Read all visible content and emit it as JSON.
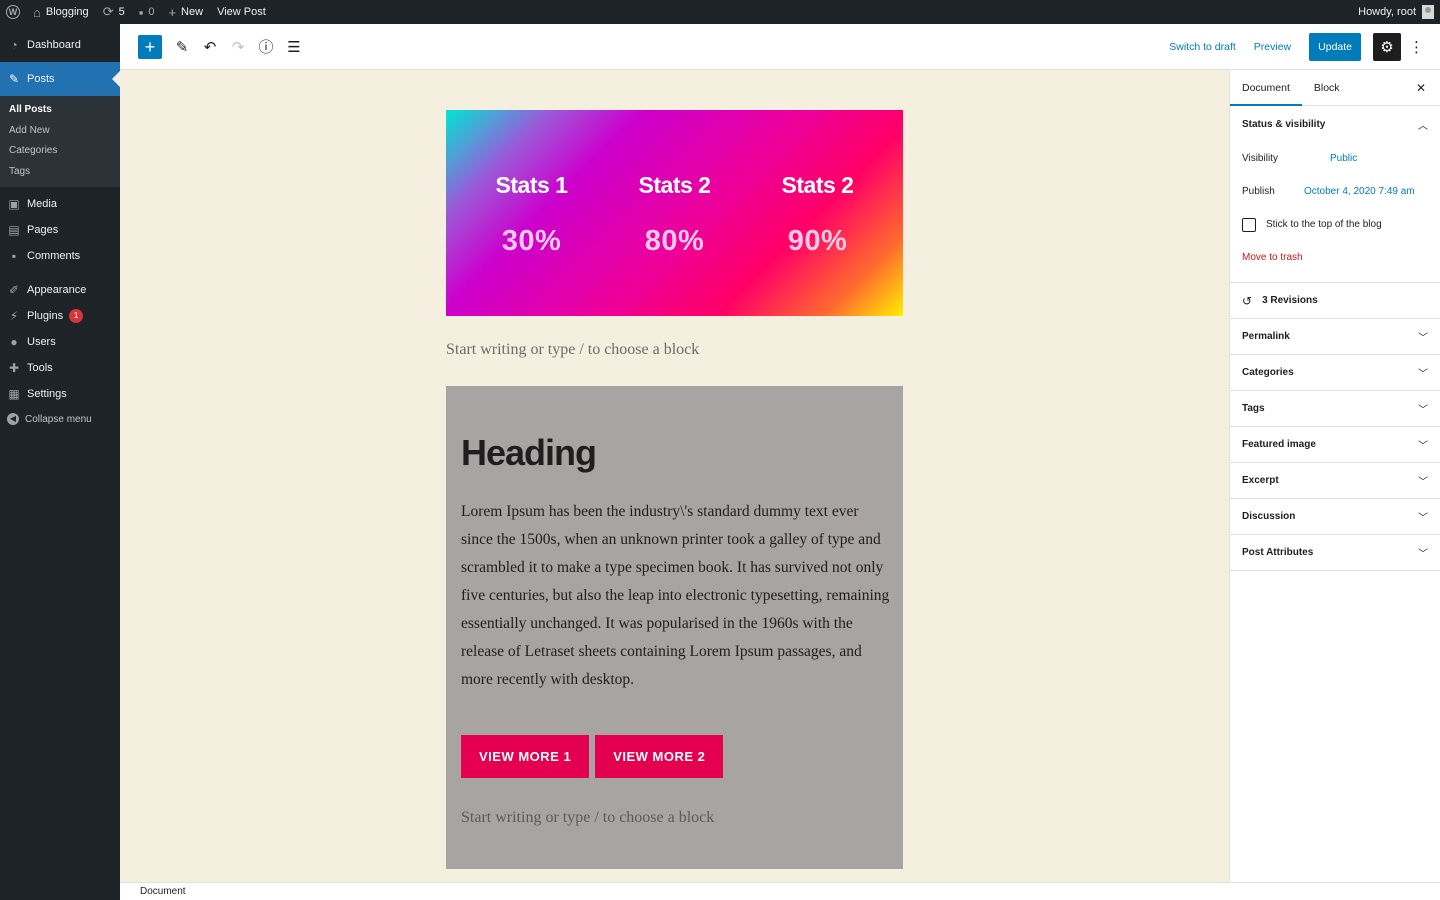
{
  "admin_bar": {
    "site_name": "Blogging",
    "updates_count": "5",
    "comments_count": "0",
    "new_label": "New",
    "view_post_label": "View Post",
    "greeting": "Howdy, root"
  },
  "menu": {
    "dashboard": "Dashboard",
    "posts": "Posts",
    "posts_sub": [
      "All Posts",
      "Add New",
      "Categories",
      "Tags"
    ],
    "media": "Media",
    "pages": "Pages",
    "comments": "Comments",
    "appearance": "Appearance",
    "plugins": "Plugins",
    "plugins_badge": "1",
    "users": "Users",
    "tools": "Tools",
    "settings": "Settings",
    "collapse": "Collapse menu"
  },
  "toolbar": {
    "switch_to_draft": "Switch to draft",
    "preview": "Preview",
    "update": "Update"
  },
  "content": {
    "stats": [
      {
        "title": "Stats 1",
        "value": "30%"
      },
      {
        "title": "Stats 2",
        "value": "80%"
      },
      {
        "title": "Stats 2",
        "value": "90%"
      }
    ],
    "placeholder": "Start writing or type / to choose a block",
    "cover_heading": "Heading",
    "cover_body": "Lorem Ipsum has been the industry\\'s standard dummy text ever since the 1500s, when an unknown printer took a galley of type and scrambled it to make a type specimen book. It has survived not only five centuries, but also the leap into electronic typesetting, remaining essentially unchanged. It was popularised in the 1960s with the release of Letraset sheets containing Lorem Ipsum passages, and more recently with desktop.",
    "button1": "VIEW MORE 1",
    "button2": "VIEW MORE 2",
    "placeholder2": "Start writing or type / to choose a block"
  },
  "sidebar": {
    "tab_document": "Document",
    "tab_block": "Block",
    "status_visibility": "Status & visibility",
    "visibility_label": "Visibility",
    "visibility_value": "Public",
    "publish_label": "Publish",
    "publish_value": "October 4, 2020 7:49 am",
    "sticky_label": "Stick to the top of the blog",
    "move_to_trash": "Move to trash",
    "revisions": "3 Revisions",
    "panels": [
      "Permalink",
      "Categories",
      "Tags",
      "Featured image",
      "Excerpt",
      "Discussion",
      "Post Attributes"
    ]
  },
  "footer": {
    "breadcrumb": "Document"
  }
}
